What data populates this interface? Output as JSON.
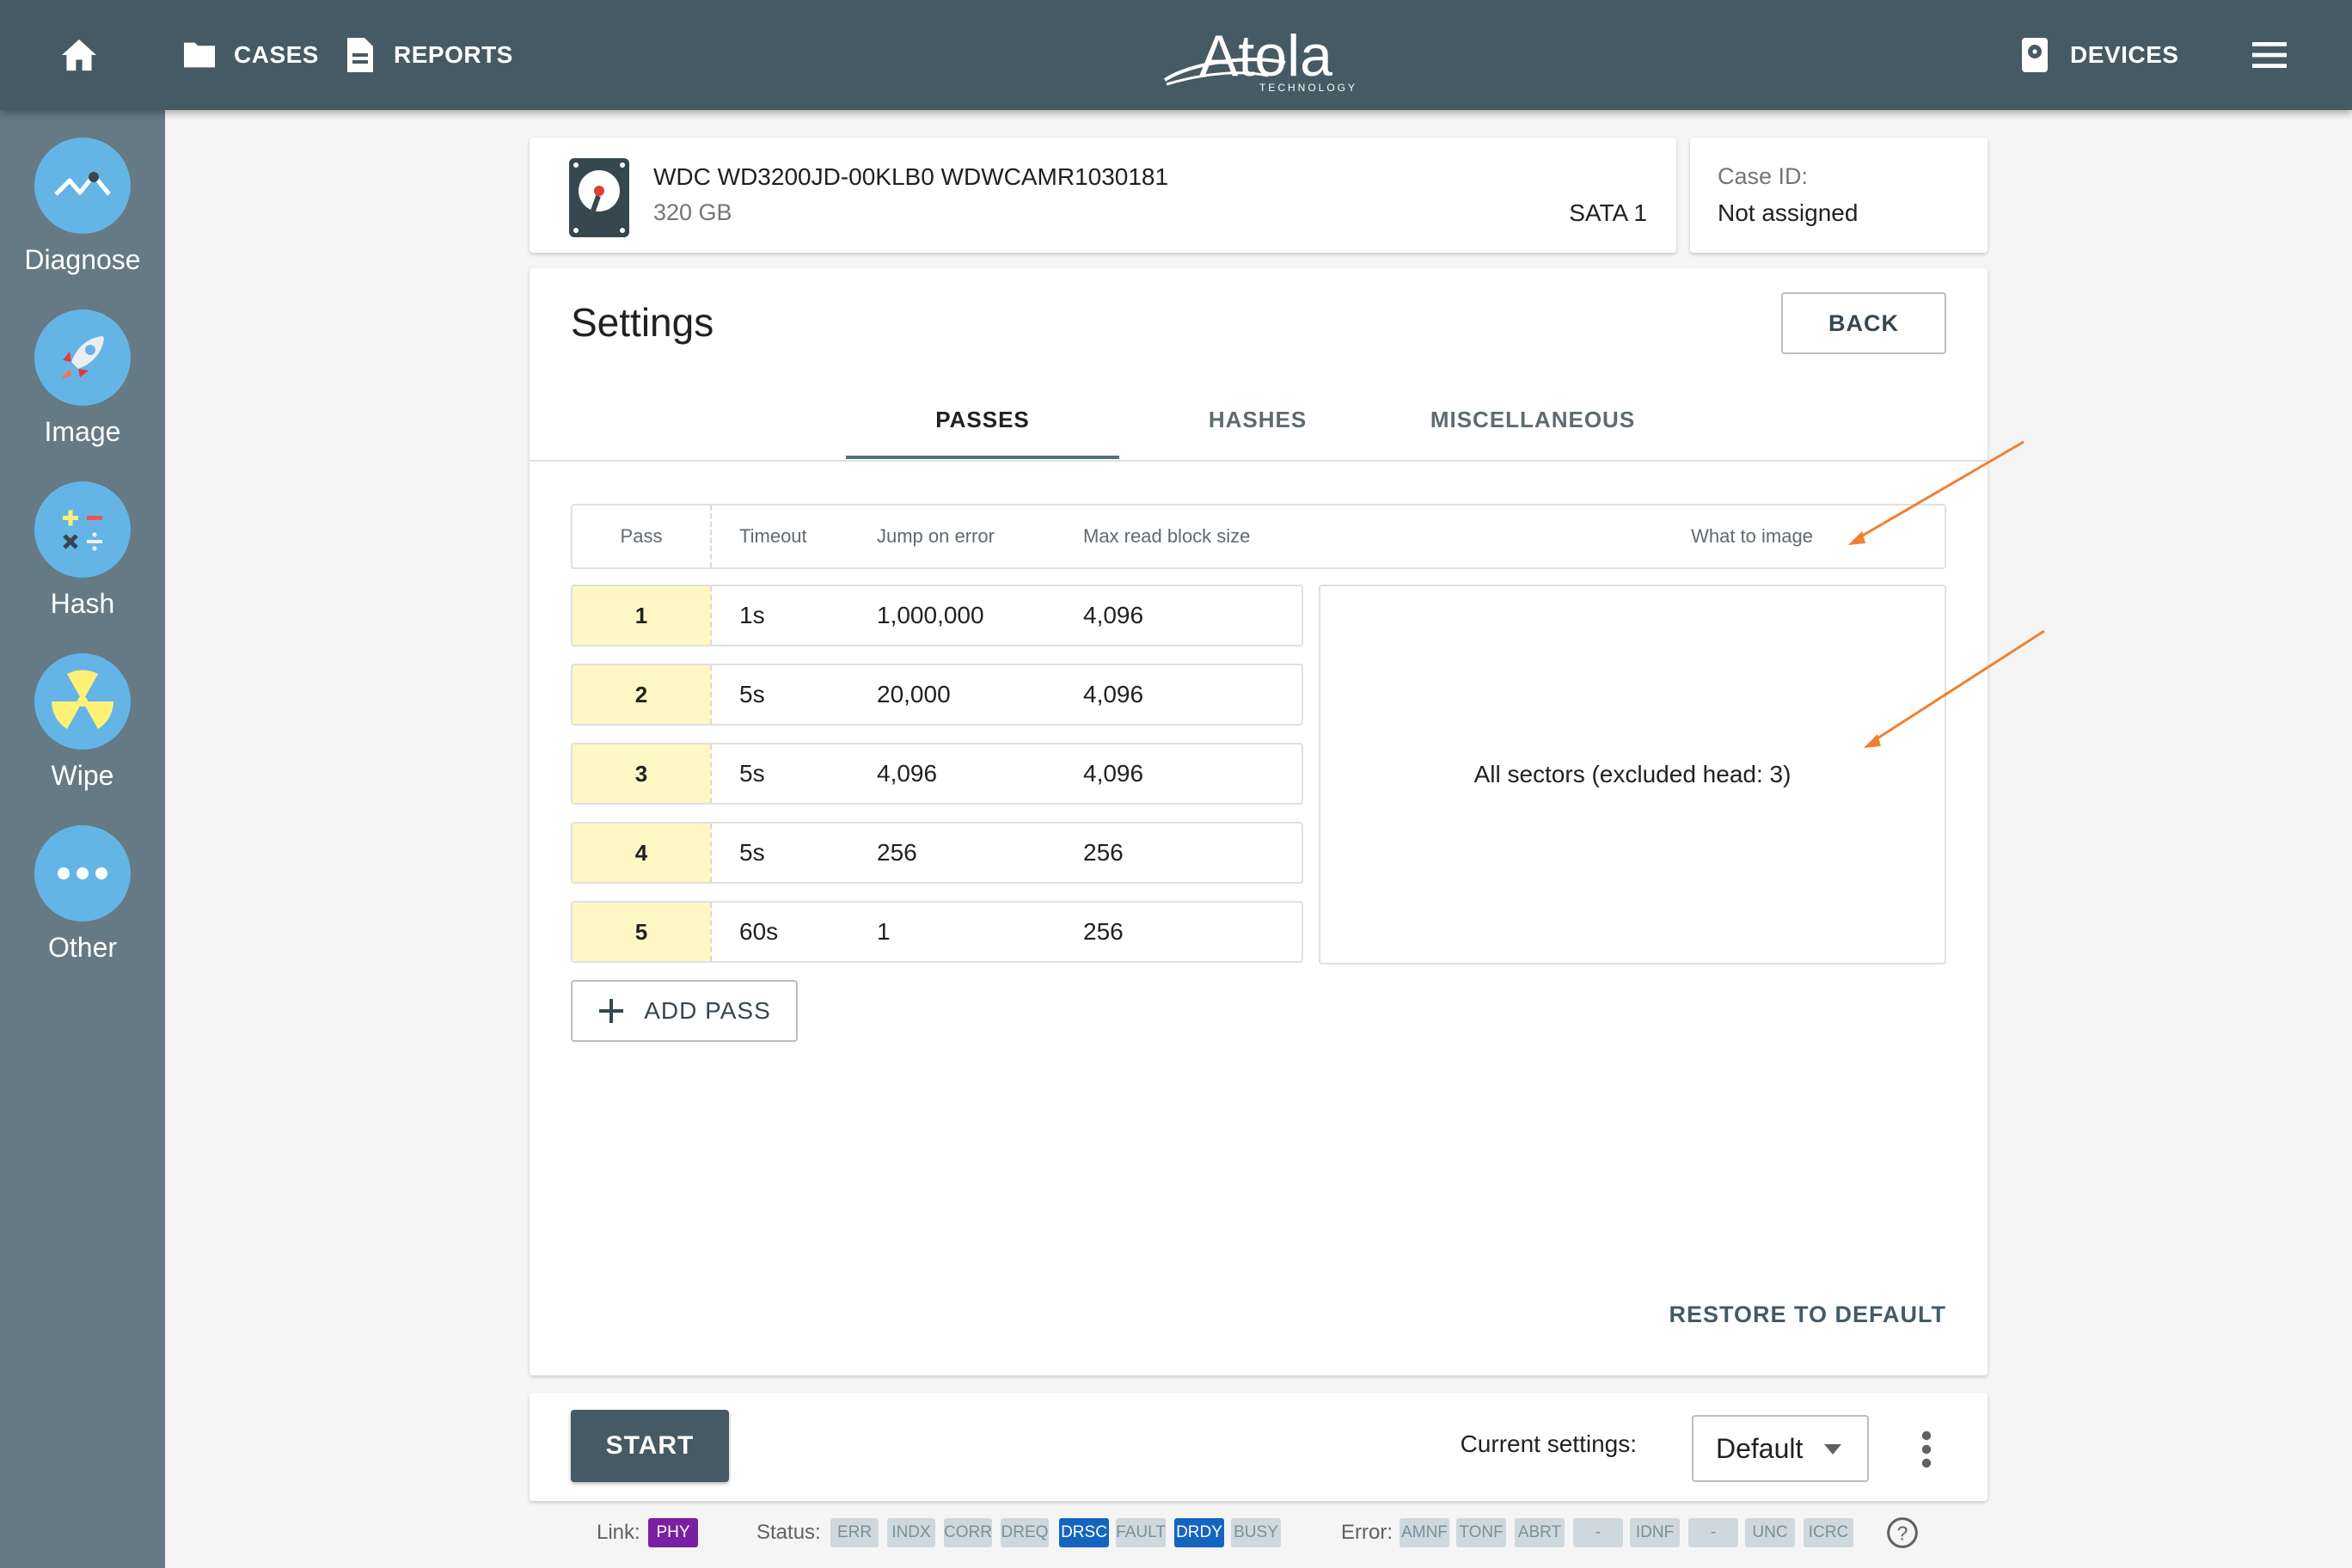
{
  "topbar": {
    "cases_label": "CASES",
    "reports_label": "REPORTS",
    "devices_label": "DEVICES",
    "logo_text": "Atola",
    "logo_subtext": "TECHNOLOGY"
  },
  "sidebar": {
    "items": [
      {
        "label": "Diagnose",
        "icon": "diagnose-icon"
      },
      {
        "label": "Image",
        "icon": "rocket-icon"
      },
      {
        "label": "Hash",
        "icon": "calculator-icon"
      },
      {
        "label": "Wipe",
        "icon": "radiation-icon"
      },
      {
        "label": "Other",
        "icon": "more-dots-icon"
      }
    ]
  },
  "device": {
    "name": "WDC WD3200JD-00KLB0 WDWCAMR1030181",
    "capacity": "320 GB",
    "port": "SATA 1"
  },
  "case": {
    "label": "Case ID:",
    "value": "Not assigned"
  },
  "settings": {
    "title": "Settings",
    "back_label": "BACK",
    "tabs": [
      {
        "label": "PASSES",
        "active": true
      },
      {
        "label": "HASHES",
        "active": false
      },
      {
        "label": "MISCELLANEOUS",
        "active": false
      }
    ],
    "columns": {
      "pass": "Pass",
      "timeout": "Timeout",
      "jump": "Jump on error",
      "block": "Max read block size",
      "what": "What to image"
    },
    "passes": [
      {
        "pass": "1",
        "timeout": "1s",
        "jump": "1,000,000",
        "block": "4,096"
      },
      {
        "pass": "2",
        "timeout": "5s",
        "jump": "20,000",
        "block": "4,096"
      },
      {
        "pass": "3",
        "timeout": "5s",
        "jump": "4,096",
        "block": "4,096"
      },
      {
        "pass": "4",
        "timeout": "5s",
        "jump": "256",
        "block": "256"
      },
      {
        "pass": "5",
        "timeout": "60s",
        "jump": "1",
        "block": "256"
      }
    ],
    "what_to_image": "All sectors (excluded head: 3)",
    "add_pass_label": "ADD PASS",
    "restore_label": "RESTORE TO DEFAULT"
  },
  "footer": {
    "start_label": "START",
    "current_settings_label": "Current settings:",
    "current_settings_value": "Default"
  },
  "statusbar": {
    "link_label": "Link:",
    "link_chip": "PHY",
    "status_label": "Status:",
    "status_chips": [
      {
        "text": "ERR",
        "on": false
      },
      {
        "text": "INDX",
        "on": false
      },
      {
        "text": "CORR",
        "on": false
      },
      {
        "text": "DREQ",
        "on": false
      },
      {
        "text": "DRSC",
        "on": true
      },
      {
        "text": "FAULT",
        "on": false
      },
      {
        "text": "DRDY",
        "on": true
      },
      {
        "text": "BUSY",
        "on": false
      }
    ],
    "error_label": "Error:",
    "error_chips": [
      {
        "text": "AMNF"
      },
      {
        "text": "TONF"
      },
      {
        "text": "ABRT"
      },
      {
        "text": "-"
      },
      {
        "text": "IDNF"
      },
      {
        "text": "-"
      },
      {
        "text": "UNC"
      },
      {
        "text": "ICRC"
      }
    ]
  },
  "colors": {
    "topbar": "#455a64",
    "sidebar": "#657a84",
    "accent_blue": "#64b5e6",
    "pass_cell": "#fff8c4",
    "annotation_arrow": "#f08030",
    "chip_active": "#1565c0",
    "chip_phy": "#7b1fa2"
  }
}
